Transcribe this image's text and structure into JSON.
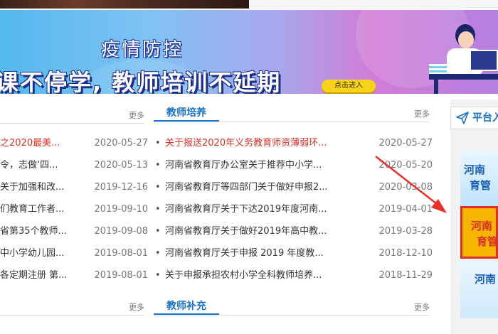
{
  "banner": {
    "subtitle": "疫情防控",
    "title": "课不停学, 教师培训不延期",
    "button_label": "点击进入"
  },
  "left_column": {
    "more_label": "更多",
    "items": [
      {
        "title": "之2020最美...",
        "date": "2020-05-27",
        "highlight": true
      },
      {
        "title": "令，志做‘四...",
        "date": "2020-05-13",
        "highlight": false
      },
      {
        "title": "关于加强和改...",
        "date": "2019-12-16",
        "highlight": false
      },
      {
        "title": "们教育工作者...",
        "date": "2019-09-10",
        "highlight": false
      },
      {
        "title": "省第35个教师...",
        "date": "2019-09-08",
        "highlight": false
      },
      {
        "title": "中小学幼儿园...",
        "date": "2019-08-01",
        "highlight": false
      },
      {
        "title": "各定期注册 第...",
        "date": "2019-08-01",
        "highlight": false
      }
    ],
    "next_more_label": "更多"
  },
  "mid_column": {
    "title": "教师培养",
    "more_label": "更多",
    "bullet": "•",
    "items": [
      {
        "title": "关于报送2020年义务教育师资薄弱环...",
        "date": "2020-05-27",
        "highlight": true
      },
      {
        "title": "河南省教育厅办公室关于推荐中小学...",
        "date": "2020-05-20",
        "highlight": false
      },
      {
        "title": "河南省教育厅等四部门关于做好申报2...",
        "date": "2020-03-08",
        "highlight": false
      },
      {
        "title": "河南省教育厅关于下达2019年度河南...",
        "date": "2019-04-01",
        "highlight": false
      },
      {
        "title": "河南省教育厅关于做好2019年高中教...",
        "date": "2019-03-28",
        "highlight": false
      },
      {
        "title": "河南省教育厅关于申报 2019 年度教...",
        "date": "2018-12-10",
        "highlight": false
      },
      {
        "title": "关于申报承担农村小学全科教师培养...",
        "date": "2018-11-29",
        "highlight": false
      }
    ],
    "next_title": "教师补充",
    "next_more_label": "更多"
  },
  "sidebar": {
    "title": "平台入",
    "cards": [
      {
        "line1": "河南",
        "line2": "育管"
      },
      {
        "line1": "河南",
        "line2": "育管"
      },
      {
        "line1": "河南"
      }
    ]
  },
  "colors": {
    "accent": "#1a73c4",
    "hot": "#d93025",
    "arrow": "#e8302a"
  }
}
